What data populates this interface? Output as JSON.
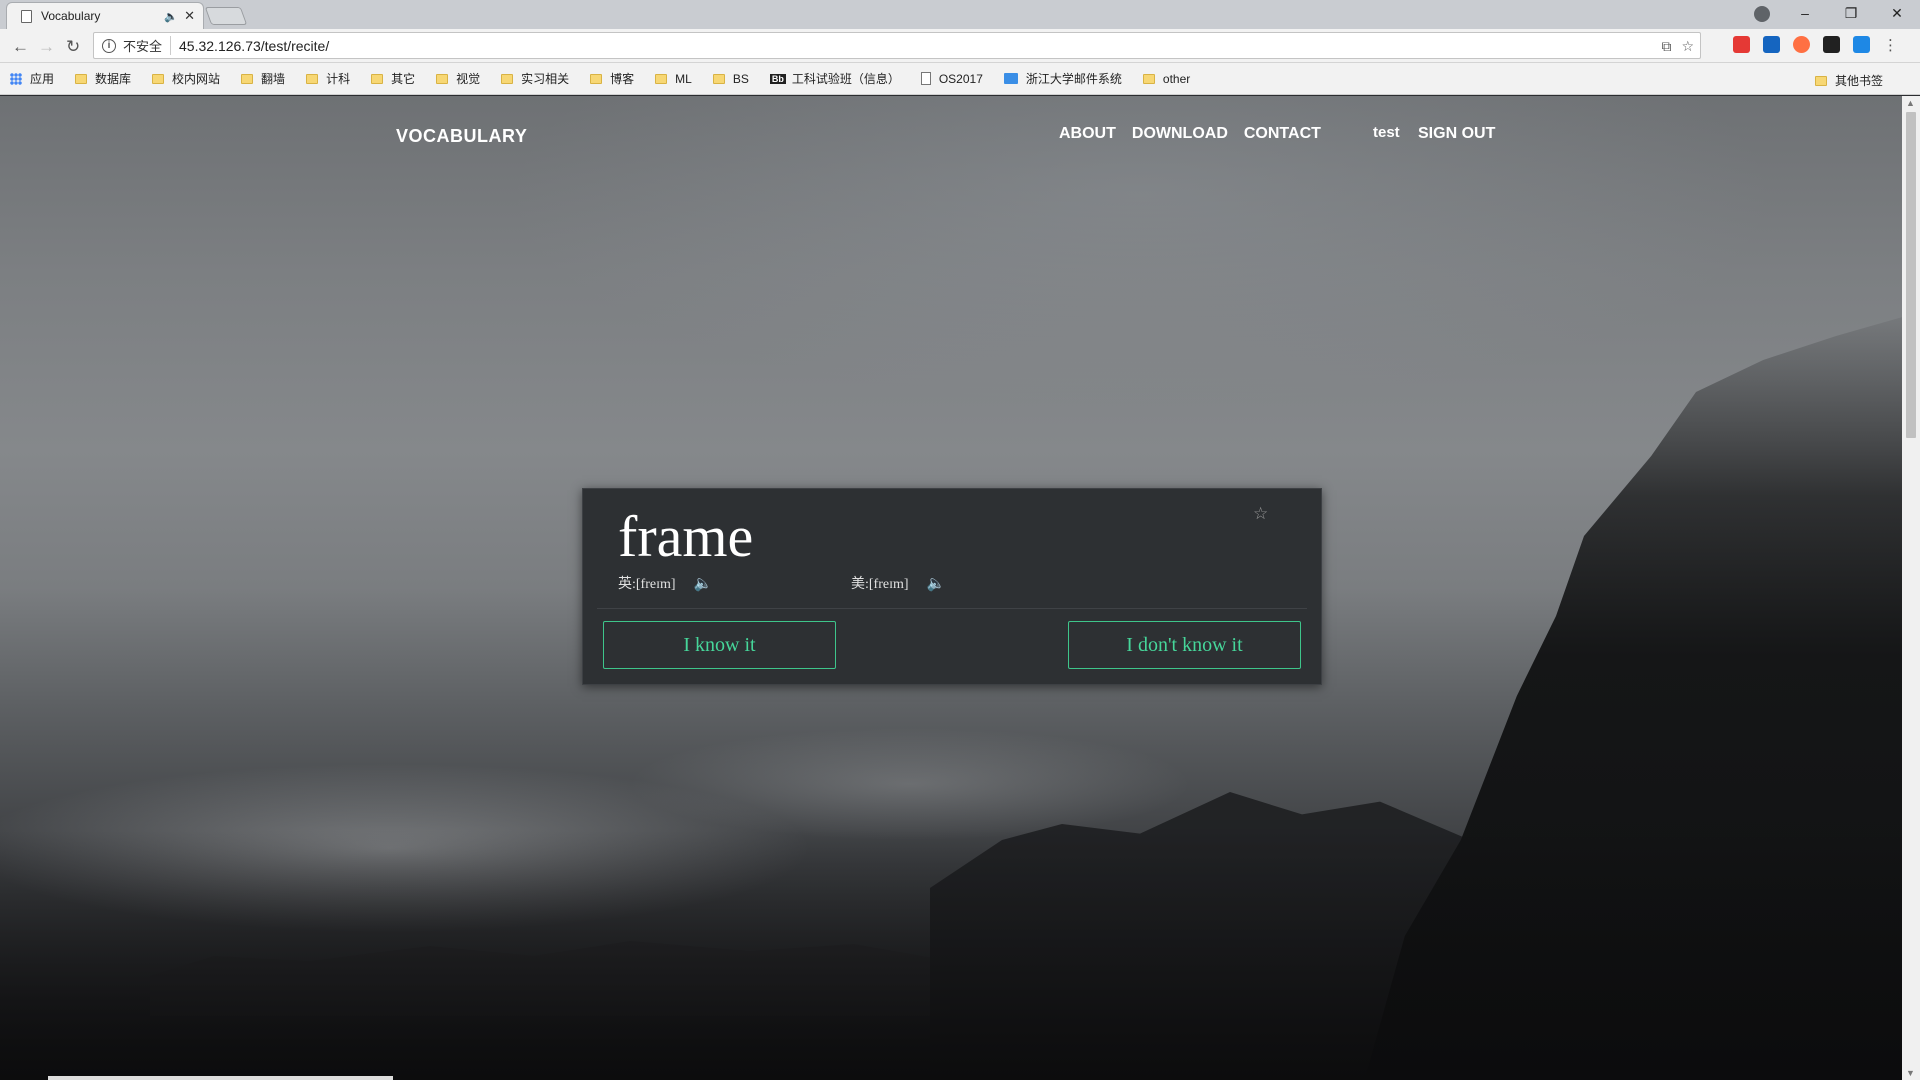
{
  "browser": {
    "tab_title": "Vocabulary",
    "address": {
      "security_label": "不安全",
      "url": "45.32.126.73/test/recite/"
    },
    "bookmarks": [
      "应用",
      "数据库",
      "校内网站",
      "翻墙",
      "计科",
      "其它",
      "视觉",
      "实习相关",
      "博客",
      "ML",
      "BS",
      "工科试验班（信息）",
      "OS2017",
      "浙江大学邮件系统",
      "other"
    ],
    "bookmarks_right": "其他书签",
    "extension_colors": [
      "#e53935",
      "#1565c0",
      "#ff7043",
      "#212121",
      "#1e88e5"
    ]
  },
  "site": {
    "brand": "VOCABULARY",
    "nav": {
      "about": "ABOUT",
      "download": "DOWNLOAD",
      "contact": "CONTACT",
      "user": "test",
      "signout": "SIGN OUT"
    }
  },
  "card": {
    "word": "frame",
    "uk_pron": "英:[freɪm]",
    "us_pron": "美:[freɪm]",
    "know_label": "I know it",
    "dont_know_label": "I don't know it",
    "accent_color": "#46d69a"
  }
}
